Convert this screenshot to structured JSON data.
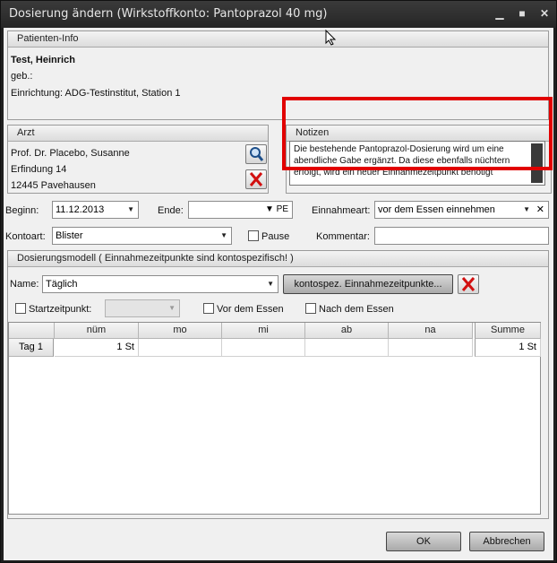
{
  "window": {
    "title": "Dosierung ändern (Wirkstoffkonto: Pantoprazol 40 mg)"
  },
  "patient": {
    "header": "Patienten-Info",
    "name": "Test, Heinrich",
    "dob": "geb.:",
    "facility": "Einrichtung: ADG-Testinstitut, Station 1"
  },
  "doctor": {
    "header": "Arzt",
    "name": "Prof. Dr. Placebo, Susanne",
    "street": "Erfindung 14",
    "city": "12445  Pavehausen"
  },
  "notes": {
    "header": "Notizen",
    "text": "Die bestehende Pantoprazol-Dosierung wird um eine abendliche Gabe ergänzt. Da diese ebenfalls nüchtern erfolgt, wird ein neuer Einnahmezeitpunkt benötigt"
  },
  "form": {
    "begin_label": "Beginn:",
    "begin_value": "11.12.2013",
    "end_label": "Ende:",
    "end_value": "",
    "end_suffix": "PE",
    "intake_label": "Einnahmeart:",
    "intake_value": "vor dem Essen einnehmen",
    "account_label": "Kontoart:",
    "account_value": "Blister",
    "pause_label": "Pause",
    "comment_label": "Kommentar:",
    "comment_value": ""
  },
  "dosing": {
    "header": "Dosierungsmodell  ( Einnahmezeitpunkte sind kontospezifisch! )",
    "name_label": "Name:",
    "name_value": "Täglich",
    "timepoints_button": "kontospez. Einnahmezeitpunkte...",
    "start_label": "Startzeitpunkt:",
    "before_meal_label": "Vor dem Essen",
    "after_meal_label": "Nach dem Essen",
    "columns": [
      "nüm",
      "mo",
      "mi",
      "ab",
      "na",
      "Summe"
    ],
    "rows": [
      {
        "label": "Tag 1",
        "cells": [
          "1 St",
          "",
          "",
          "",
          "",
          "1 St"
        ]
      }
    ]
  },
  "buttons": {
    "ok": "OK",
    "cancel": "Abbrechen"
  },
  "colors": {
    "highlight_frame": "#e10000",
    "titlebar": "#2a2a2a"
  }
}
